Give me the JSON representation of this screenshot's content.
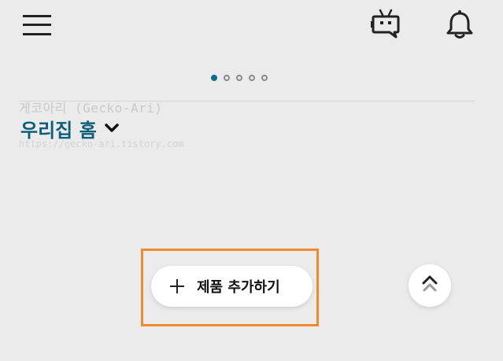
{
  "header": {
    "menu_icon": "hamburger-menu-icon",
    "bot_icon": "chatbot-icon",
    "notification_icon": "bell-icon"
  },
  "carousel": {
    "page_count": 5,
    "active_index": 0
  },
  "watermark": {
    "text": "게코아리 (Gecko-Ari)",
    "url": "https://gecko-ari.tistory.com"
  },
  "home": {
    "title": "우리집 홈",
    "dropdown_icon": "chevron-down-icon"
  },
  "actions": {
    "add_product_label": "제품 추가하기",
    "scroll_top_icon": "double-chevron-up-icon"
  },
  "colors": {
    "background": "#ebebeb",
    "accent": "#0d6e8a",
    "title": "#0d5e78",
    "highlight": "#f08a2c"
  }
}
